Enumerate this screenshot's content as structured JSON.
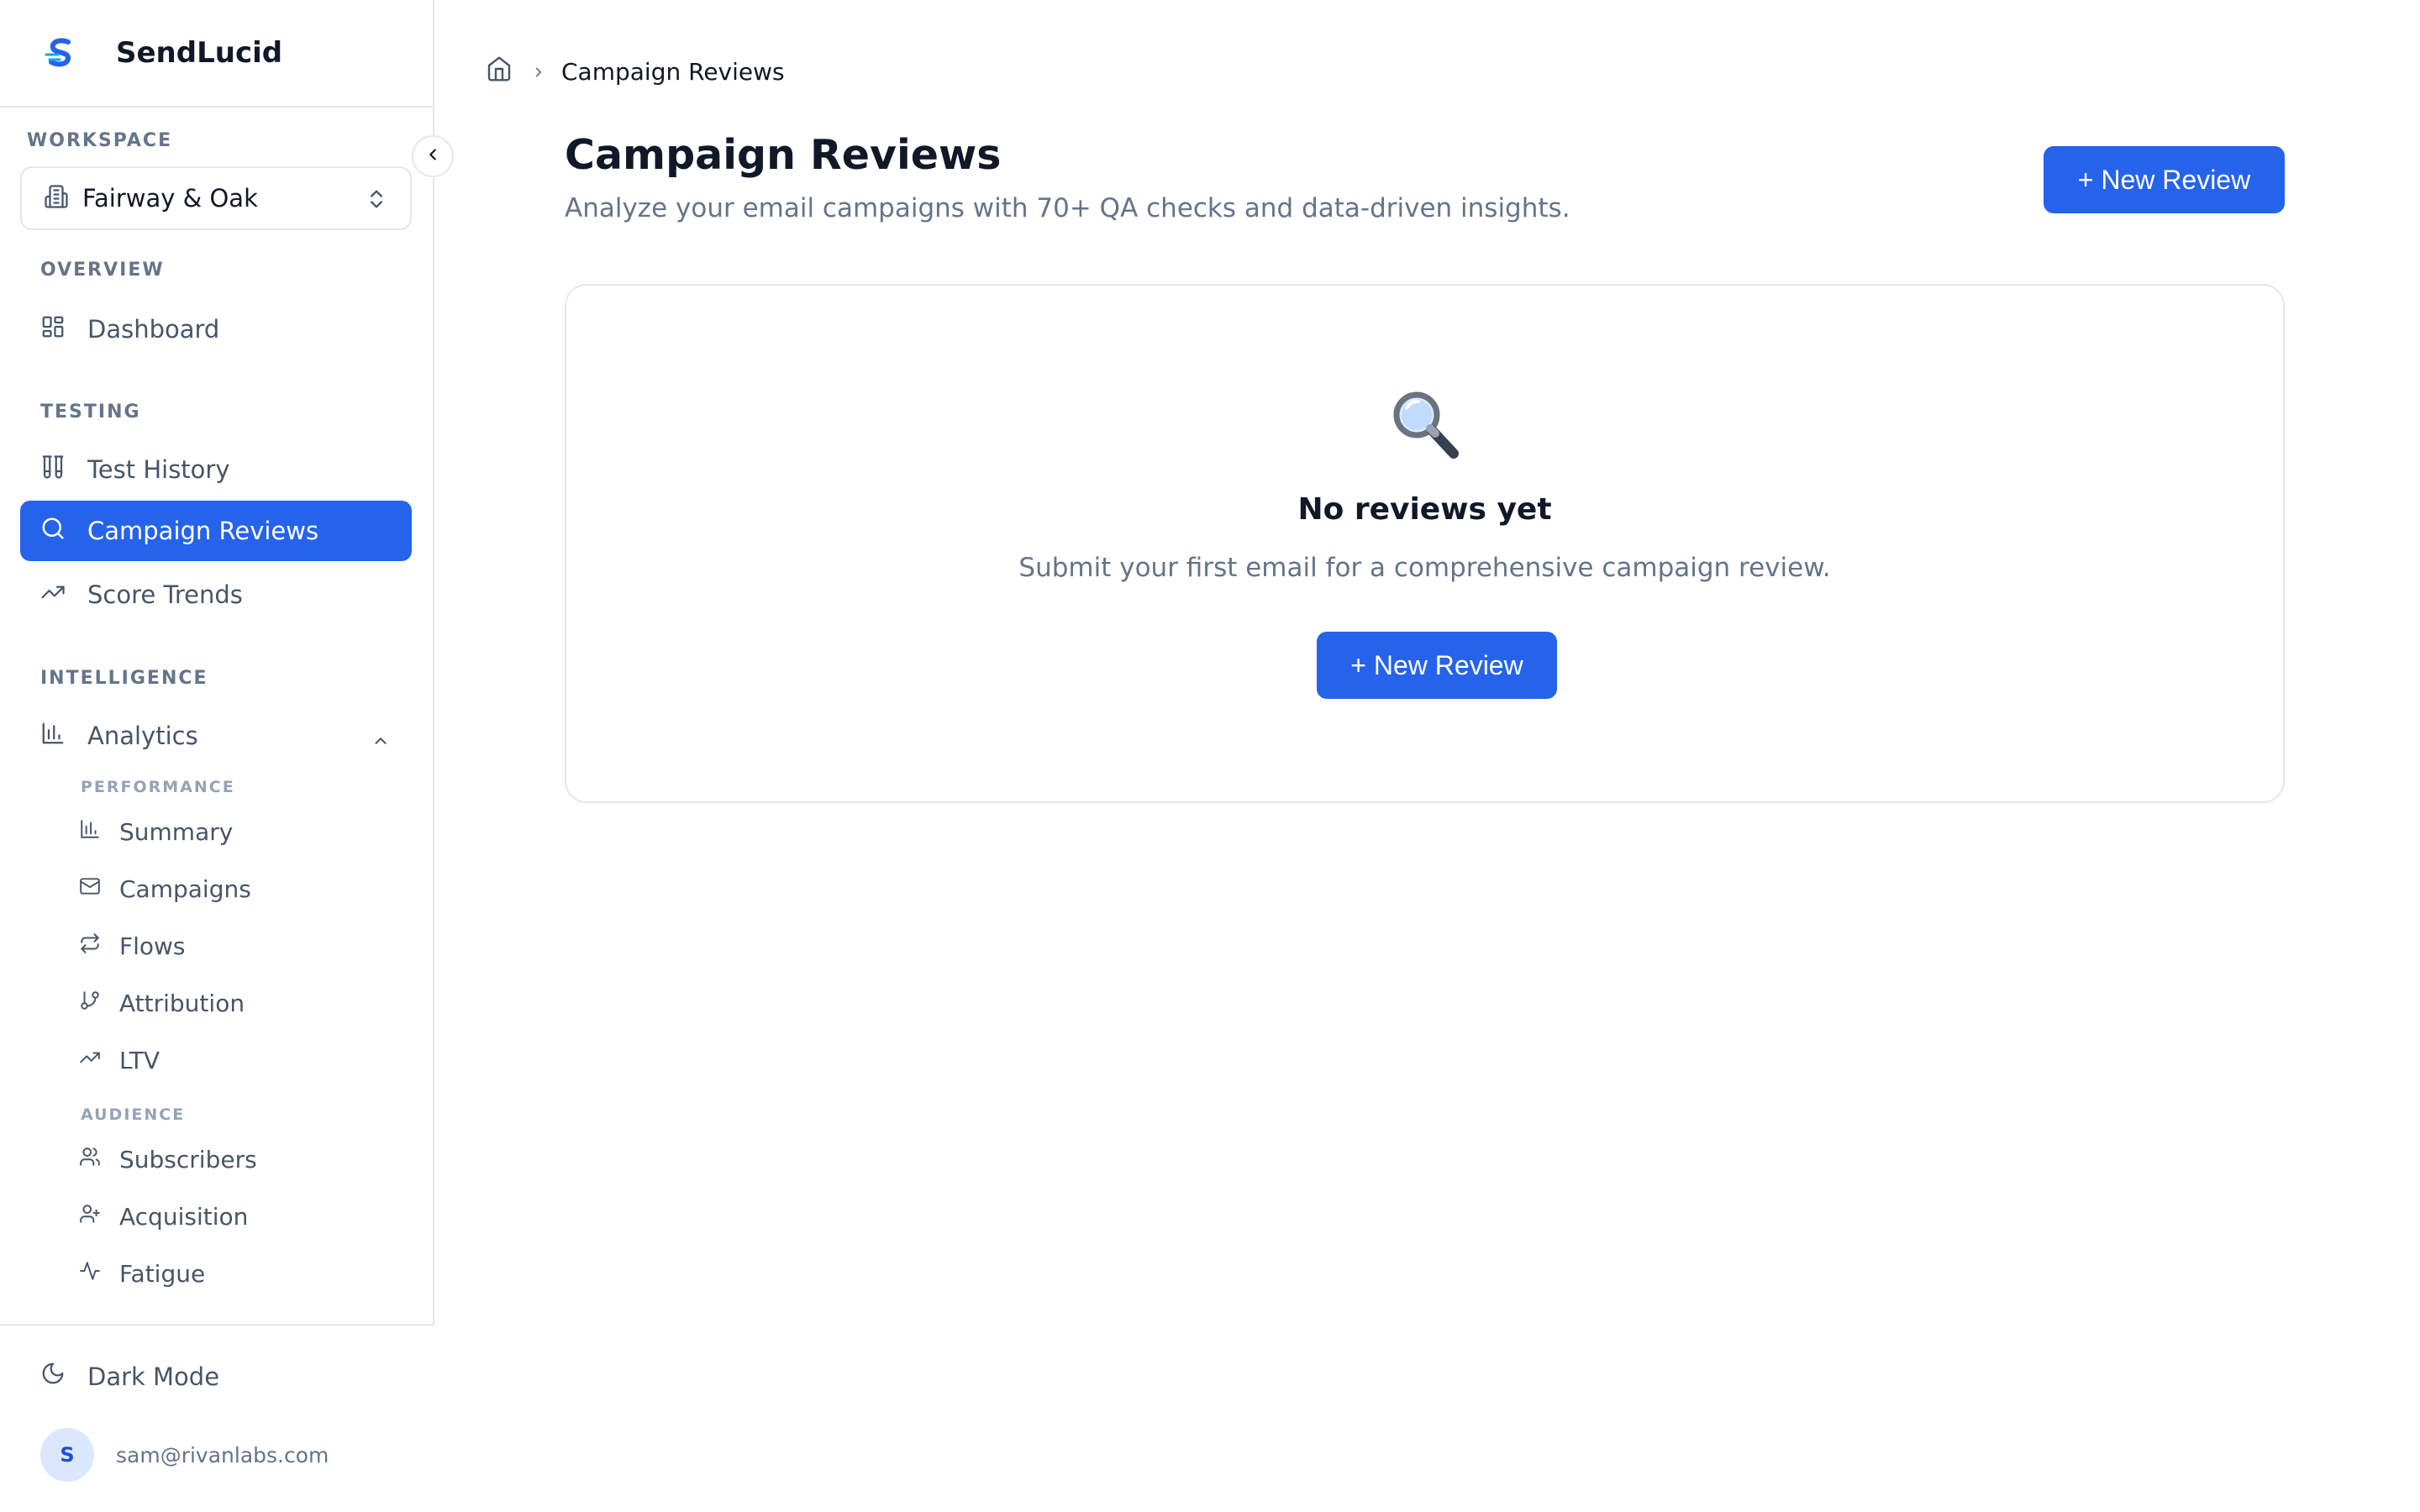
{
  "brand": {
    "name": "SendLucid"
  },
  "workspace": {
    "section_title": "WORKSPACE",
    "selected": "Fairway & Oak"
  },
  "sidebar": {
    "overview_title": "OVERVIEW",
    "dashboard": "Dashboard",
    "testing_title": "TESTING",
    "test_history": "Test History",
    "campaign_reviews": "Campaign Reviews",
    "score_trends": "Score Trends",
    "intelligence_title": "INTELLIGENCE",
    "analytics": "Analytics",
    "performance_title": "PERFORMANCE",
    "summary": "Summary",
    "campaigns": "Campaigns",
    "flows": "Flows",
    "attribution": "Attribution",
    "ltv": "LTV",
    "audience_title": "AUDIENCE",
    "subscribers": "Subscribers",
    "acquisition": "Acquisition",
    "fatigue": "Fatigue"
  },
  "footer": {
    "dark_mode": "Dark Mode",
    "avatar_initial": "S",
    "email": "sam@rivanlabs.com"
  },
  "breadcrumb": {
    "current": "Campaign Reviews"
  },
  "page": {
    "title": "Campaign Reviews",
    "subtitle": "Analyze your email campaigns with 70+ QA checks and data-driven insights.",
    "new_review_label": "+ New Review"
  },
  "empty_state": {
    "icon": "magnifier-emoji",
    "title": "No reviews yet",
    "text": "Submit your first email for a comprehensive campaign review.",
    "button_label": "+ New Review"
  },
  "colors": {
    "accent": "#2563eb",
    "text": "#111827",
    "muted": "#64748b",
    "border": "#e5e7eb"
  }
}
